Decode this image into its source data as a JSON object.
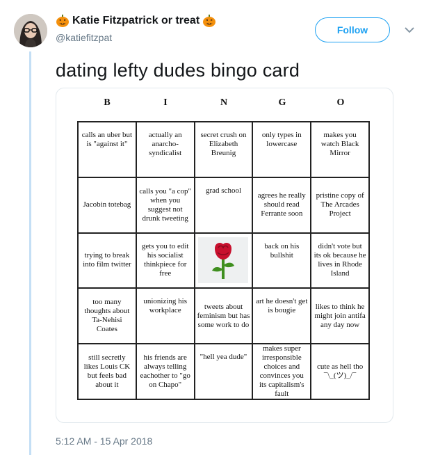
{
  "tweet": {
    "display_name": "Katie Fitzpatrick or treat",
    "handle": "@katiefitzpat",
    "follow_label": "Follow",
    "text": "dating lefty dudes bingo card",
    "timestamp": "5:12 AM - 15 Apr 2018"
  },
  "bingo": {
    "letters": [
      "B",
      "I",
      "N",
      "G",
      "O"
    ],
    "cells": [
      "calls an uber but is \"against it\"",
      "actually an anarcho-syndicalist",
      "secret crush on Elizabeth Breunig",
      "only types in lowercase",
      "makes you watch Black Mirror",
      "Jacobin totebag",
      "calls you \"a cop\" when you suggest not drunk tweeting",
      "grad school",
      "agrees he really should read Ferrante soon",
      "pristine copy of The Arcades Project",
      "trying to break into film twitter",
      "gets you to edit his socialist thinkpiece for free",
      "",
      "back on his bullshit",
      "didn't vote but its ok because he lives in Rhode Island",
      "too many thoughts about Ta-Nehisi Coates",
      "unionizing his workplace",
      "tweets about feminism but has some work to do",
      "art he doesn't get is bougie",
      "likes to think he might join antifa any day now",
      "still secretly likes Louis CK but feels bad about it",
      "his friends are always telling eachother to \"go on Chapo\"",
      "\"hell yea dude\"",
      "makes super irresponsible choices and convinces you its capitalism's fault",
      "cute as hell tho ¯\\_(ツ)_/¯"
    ],
    "free_space_icon": "rose-icon"
  },
  "colors": {
    "accent": "#1da1f2",
    "thread_line": "#c4dff5",
    "muted_text": "#657786",
    "rose": "#c8102e"
  }
}
